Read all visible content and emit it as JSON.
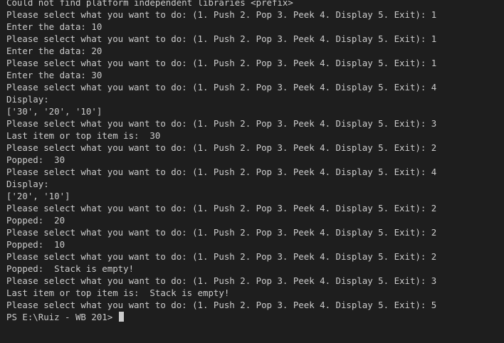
{
  "terminal": {
    "lines": [
      "Could not find platform independent libraries <prefix>",
      "Please select what you want to do: (1. Push 2. Pop 3. Peek 4. Display 5. Exit): 1",
      "Enter the data: 10",
      "Please select what you want to do: (1. Push 2. Pop 3. Peek 4. Display 5. Exit): 1",
      "Enter the data: 20",
      "Please select what you want to do: (1. Push 2. Pop 3. Peek 4. Display 5. Exit): 1",
      "Enter the data: 30",
      "Please select what you want to do: (1. Push 2. Pop 3. Peek 4. Display 5. Exit): 4",
      "Display:",
      "['30', '20', '10']",
      "Please select what you want to do: (1. Push 2. Pop 3. Peek 4. Display 5. Exit): 3",
      "Last item or top item is:  30",
      "Please select what you want to do: (1. Push 2. Pop 3. Peek 4. Display 5. Exit): 2",
      "Popped:  30",
      "Please select what you want to do: (1. Push 2. Pop 3. Peek 4. Display 5. Exit): 4",
      "Display:",
      "['20', '10']",
      "Please select what you want to do: (1. Push 2. Pop 3. Peek 4. Display 5. Exit): 2",
      "Popped:  20",
      "Please select what you want to do: (1. Push 2. Pop 3. Peek 4. Display 5. Exit): 2",
      "Popped:  10",
      "Please select what you want to do: (1. Push 2. Pop 3. Peek 4. Display 5. Exit): 2",
      "Popped:  Stack is empty!",
      "Please select what you want to do: (1. Push 2. Pop 3. Peek 4. Display 5. Exit): 3",
      "Last item or top item is:  Stack is empty!",
      "Please select what you want to do: (1. Push 2. Pop 3. Peek 4. Display 5. Exit): 5"
    ],
    "prompt": "PS E:\\Ruiz - WB 201> "
  },
  "colors": {
    "background": "#1e1e1e",
    "text": "#cccccc",
    "cursor": "#cccccc"
  }
}
